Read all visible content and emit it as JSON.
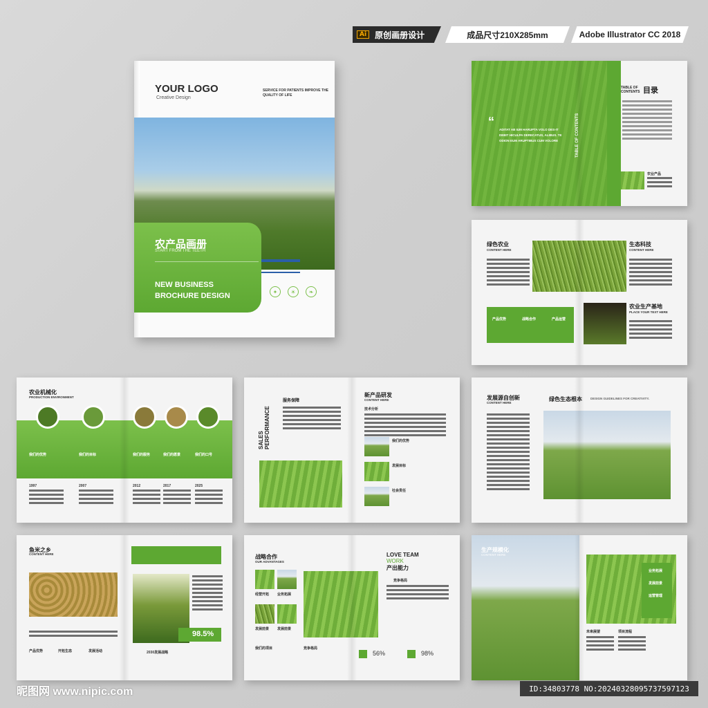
{
  "badges": {
    "type_label": "原创画册设计",
    "ai_label": "Ai",
    "size_label": "成品尺寸210X285mm",
    "software_label": "Adobe Illustrator CC 2018"
  },
  "cover": {
    "logo": "YOUR LOGO",
    "logo_sub": "Creative Design",
    "tagline": "SERVICE FOR PATIENTS IMPROVE THE QUALITY OF LIFE",
    "title_cn": "农产品画册",
    "subtitle_en": "START FROM THE TEETH",
    "title_en": "NEW BUSINESS BROCHURE DESIGN"
  },
  "toc_spread": {
    "quote": "ADITAT AB IUM HARUPTA VOLO DES-IT DEBIT HICULPA DERECATUS, ALIBUS. TE ODION EUM ARUPTIBUS CUM VOLORE",
    "toc_en": "TABLE OF CONTENTS",
    "toc_cn": "目录",
    "vertical": "TABLE OF CONTENTS",
    "caption": "农业产品"
  },
  "spread2": {
    "h1": "绿色农业",
    "h1_en": "CONTENT HERE",
    "h2": "生态科技",
    "h2_en": "CONTENT HERE",
    "h3": "农业生产基地",
    "h3_en": "PLACE YOUR TEXT HERE",
    "boxes": [
      "产品优势",
      "战略合作",
      "产品运营"
    ]
  },
  "spread3": {
    "h_cn": "农业机械化",
    "h_en": "PRODUCTION ENVIRONMENT",
    "labels": [
      "我们的优势",
      "我们的目标",
      "我们的服务",
      "我们的愿景",
      "我们的口号"
    ],
    "years": [
      "1997",
      "2007",
      "2012",
      "2017",
      "2025"
    ]
  },
  "spread4": {
    "h_cn": "服务保障",
    "vertical": "SALES PERFORMANCE",
    "h2_cn": "新产品研发",
    "h2_en": "CONTENT HERE",
    "sub": "技术分析",
    "items": [
      "我们的优势",
      "发展目标",
      "社会责任"
    ]
  },
  "spread5": {
    "h_cn": "发展源自创新",
    "h_en": "CONTENT HERE",
    "banner": "绿色生态根本",
    "banner_en": "DESIGN GUIDELINES FOR CREATIVITY."
  },
  "spread6": {
    "h_cn": "鱼米之乡",
    "h_en": "CONTENT HERE",
    "stat": "98.5%",
    "items": [
      "产品优势",
      "开拓生态",
      "发展活动"
    ],
    "caption": "2030发展战略"
  },
  "spread7": {
    "h_cn": "战略合作",
    "h_en": "OUR ADVANTAGES",
    "h2_en1": "LOVE TEAM",
    "h2_en2": "WORK",
    "h2_cn": "产出能力",
    "sub": "竞争格局",
    "thumbs": [
      "经营开拓",
      "业务拓展",
      "发展前景",
      "发展前景"
    ],
    "bottom": [
      "我们的项目",
      "竞争格局"
    ],
    "stat1": "56%",
    "stat2": "98%"
  },
  "spread8": {
    "h_cn": "生产规模化",
    "h_en": "CONTENT HERE",
    "labels": [
      "未来展望",
      "项目流程"
    ],
    "tags": [
      "业务拓展",
      "发展前景",
      "运营管理"
    ]
  },
  "footer": {
    "watermark": "昵图网 www.nipic.com",
    "id": "ID:34803778 NO:20240328095737597123"
  },
  "colors": {
    "brand_green": "#5da832",
    "light_green": "#7cc04b",
    "dark": "#2b2b2b"
  }
}
